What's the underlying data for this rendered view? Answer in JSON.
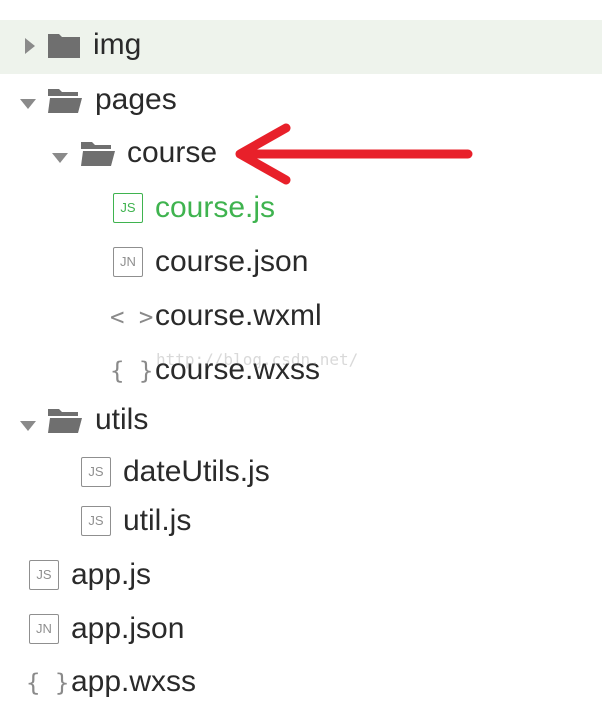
{
  "tree": {
    "img": {
      "label": "img",
      "icon": "folder-icon",
      "expanded": false
    },
    "pages": {
      "label": "pages",
      "icon": "folder-open-icon",
      "expanded": true
    },
    "course": {
      "label": "course",
      "icon": "folder-open-icon",
      "expanded": true
    },
    "course_js": {
      "label": "course.js",
      "badge": "JS",
      "active_color": "#3fb34f"
    },
    "course_json": {
      "label": "course.json",
      "badge": "JN"
    },
    "course_wxml": {
      "label": "course.wxml",
      "glyph": "< >"
    },
    "course_wxss": {
      "label": "course.wxss",
      "glyph": "{ }"
    },
    "utils": {
      "label": "utils",
      "icon": "folder-open-icon",
      "expanded": true
    },
    "dateUtils_js": {
      "label": "dateUtils.js",
      "badge": "JS"
    },
    "util_js": {
      "label": "util.js",
      "badge": "JS"
    },
    "app_js": {
      "label": "app.js",
      "badge": "JS"
    },
    "app_json": {
      "label": "app.json",
      "badge": "JN"
    },
    "app_wxss": {
      "label": "app.wxss",
      "glyph": "{ }"
    }
  },
  "annotation": {
    "arrow_color": "#e8202a",
    "watermark": "http://blog.csdn.net/"
  },
  "colors": {
    "selected_row_bg": "#eef3ec",
    "active_text": "#3fb34f",
    "icon_gray": "#8a8a8a"
  }
}
